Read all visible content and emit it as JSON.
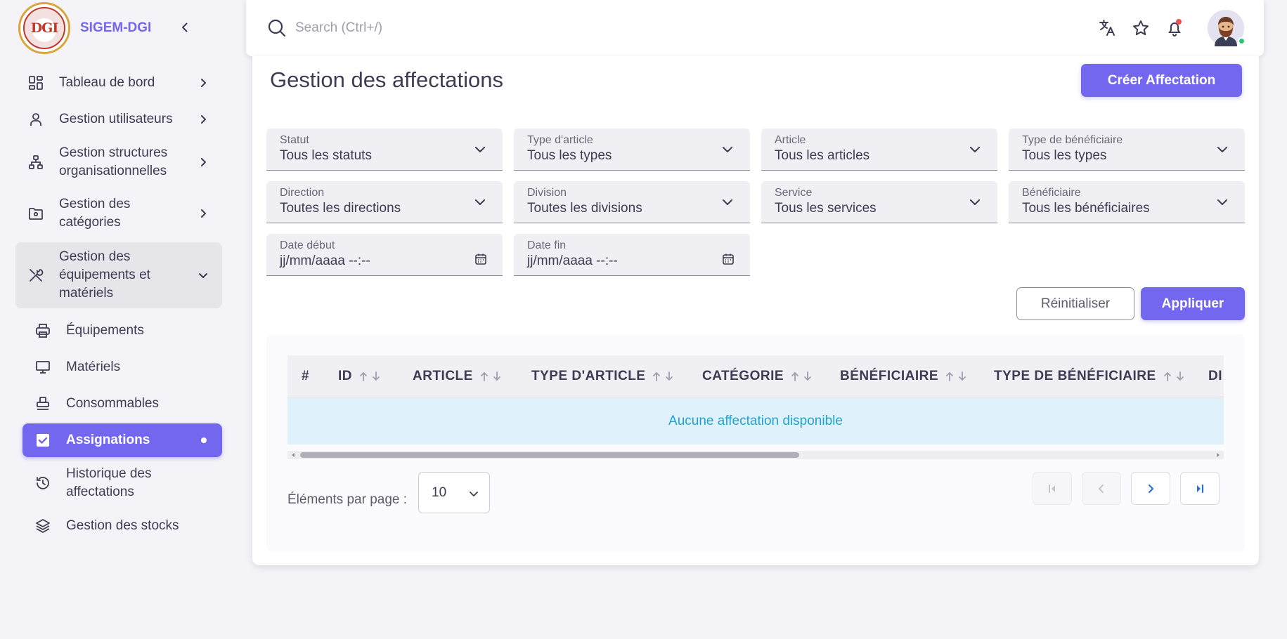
{
  "app": {
    "brand_name": "SIGEM-DGI",
    "logo_text": "DGI"
  },
  "search": {
    "placeholder": "Search (Ctrl+/)"
  },
  "sidebar": {
    "items": [
      {
        "label": "Tableau de bord",
        "icon": "dashboard-icon"
      },
      {
        "label": "Gestion utilisateurs",
        "icon": "user-icon"
      },
      {
        "label": "Gestion structures organisationnelles",
        "icon": "sitemap-icon"
      },
      {
        "label": "Gestion des catégories",
        "icon": "folder-settings-icon"
      },
      {
        "label": "Gestion des équipements et matériels",
        "icon": "tools-icon",
        "expanded": true
      }
    ],
    "sub_items": [
      {
        "label": "Équipements",
        "icon": "printer-icon"
      },
      {
        "label": "Matériels",
        "icon": "monitor-icon"
      },
      {
        "label": "Consommables",
        "icon": "stamp-icon"
      },
      {
        "label": "Assignations",
        "icon": "checkbox-icon",
        "active": true
      },
      {
        "label": "Historique des affectations",
        "icon": "history-icon"
      },
      {
        "label": "Gestion des stocks",
        "icon": "layers-icon"
      }
    ]
  },
  "page": {
    "title": "Gestion des affectations",
    "create_button": "Créer Affectation"
  },
  "filters": {
    "statut": {
      "label": "Statut",
      "value": "Tous les statuts"
    },
    "type_article": {
      "label": "Type d'article",
      "value": "Tous les types"
    },
    "article": {
      "label": "Article",
      "value": "Tous les articles"
    },
    "type_beneficiaire": {
      "label": "Type de bénéficiaire",
      "value": "Tous les types"
    },
    "direction": {
      "label": "Direction",
      "value": "Toutes les directions"
    },
    "division": {
      "label": "Division",
      "value": "Toutes les divisions"
    },
    "service": {
      "label": "Service",
      "value": "Tous les services"
    },
    "beneficiaire": {
      "label": "Bénéficiaire",
      "value": "Tous les bénéficiaires"
    },
    "date_debut": {
      "label": "Date début",
      "value": "jj/mm/aaaa --:--"
    },
    "date_fin": {
      "label": "Date fin",
      "value": "jj/mm/aaaa --:--"
    }
  },
  "actions": {
    "reset": "Réinitialiser",
    "apply": "Appliquer"
  },
  "table": {
    "columns": [
      "#",
      "ID",
      "ARTICLE",
      "TYPE D'ARTICLE",
      "CATÉGORIE",
      "BÉNÉFICIAIRE",
      "TYPE DE BÉNÉFICIAIRE",
      "DI"
    ],
    "empty_message": "Aucune affectation disponible"
  },
  "pagination": {
    "per_page_label": "Éléments par page :",
    "per_page_value": "10"
  },
  "colors": {
    "accent": "#7367f0",
    "info_bg": "#dff1fb",
    "info_text": "#1fa3d6"
  }
}
